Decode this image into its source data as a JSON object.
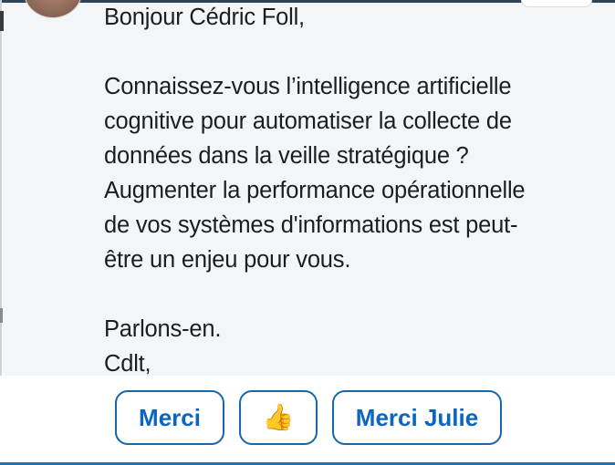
{
  "message": {
    "greeting": "Bonjour Cédric Foll,",
    "paragraph_1": "Connaissez-vous l’intelligence artificielle\ncognitive pour automatiser la collecte de\ndonnées dans la veille stratégique ?\nAugmenter la performance opérationnelle\nde vos systèmes d'informations est peut-\nêtre un enjeu pour vous.",
    "closing_1": "Parlons-en.",
    "closing_2": "Cdlt,"
  },
  "quick_replies": {
    "merci": "Merci",
    "thumbs_up": "👍",
    "merci_julie": "Merci Julie"
  },
  "colors": {
    "accent": "#0a66c2",
    "message_background": "#f3f6f8",
    "text": "#1d1d1d"
  }
}
